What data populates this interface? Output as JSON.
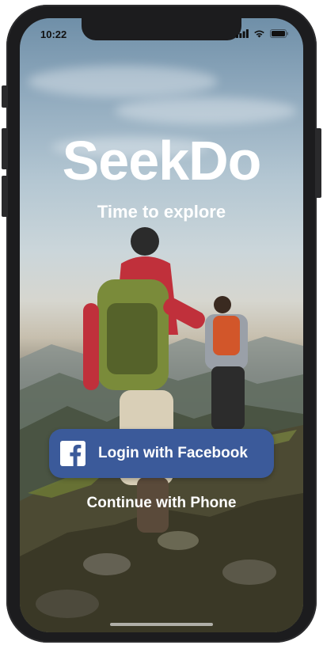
{
  "status_bar": {
    "time": "10:22",
    "icons": [
      "cellular-signal-icon",
      "wifi-icon",
      "battery-icon"
    ]
  },
  "app": {
    "title": "SeekDo",
    "tagline": "Time to explore"
  },
  "actions": {
    "facebook_login_label": "Login with Facebook",
    "facebook_icon": "facebook-logo-icon",
    "phone_login_label": "Continue with Phone"
  },
  "colors": {
    "facebook_button": "#3b5a9a",
    "text_primary": "#ffffff",
    "device_frame": "#1c1c1e"
  }
}
